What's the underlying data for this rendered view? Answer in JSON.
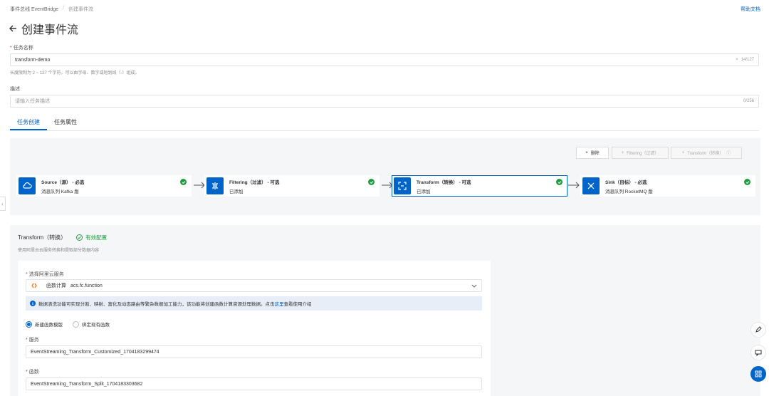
{
  "breadcrumb": {
    "root": "事件总线 EventBridge",
    "separator": "/",
    "current": "创建事件流"
  },
  "help_link": "帮助文档",
  "page_title": "创建事件流",
  "task_name": {
    "label": "任务名称",
    "value": "transform-demo",
    "counter": "14/127",
    "hint": "长度限制为 2 ~ 127 个字符，可以由字母、数字或短划线（-）组成。"
  },
  "description": {
    "label": "描述",
    "placeholder": "请输入任务描述",
    "counter": "0/256"
  },
  "tabs": [
    {
      "label": "任务创建"
    },
    {
      "label": "任务属性"
    }
  ],
  "toolbar": {
    "delete": "删除",
    "add_filtering": "Filtering（过滤）",
    "add_transform": "Transform（转换）"
  },
  "nodes": [
    {
      "title": "Source（源） - 必选",
      "subtitle": "消息队列 Kafka 版"
    },
    {
      "title": "Filtering（过滤） - 可选",
      "subtitle": "已添加"
    },
    {
      "title": "Transform（转换） - 可选",
      "subtitle": "已添加"
    },
    {
      "title": "Sink（目标） - 必选",
      "subtitle": "消息队列 RocketMQ 版"
    }
  ],
  "config": {
    "title": "Transform（转换）",
    "status": "有效配置",
    "description": "使用阿里云云服务转换和提取部分数据内容",
    "service_label": "选择阿里云服务",
    "service_name": "函数计算",
    "service_value": "acs.fc.function",
    "info_text": "数据清洗功能可实现分割、映射、富化及动态路由等繁杂数据加工能力，该功能将创建函数计算资源处理数据。点击",
    "info_link": "这里",
    "info_suffix": "查看使用介绍",
    "radio_new": "新建函数模版",
    "radio_bind": "绑定现有函数",
    "server_label": "服务",
    "server_value": "EventStreaming_Transform_Customized_1704183299474",
    "function_label": "函数",
    "function_value": "EventStreaming_Transform_Split_1704183303682"
  },
  "colors": {
    "primary": "#0064c8",
    "success": "#1e9e3f",
    "required": "#d93026"
  }
}
